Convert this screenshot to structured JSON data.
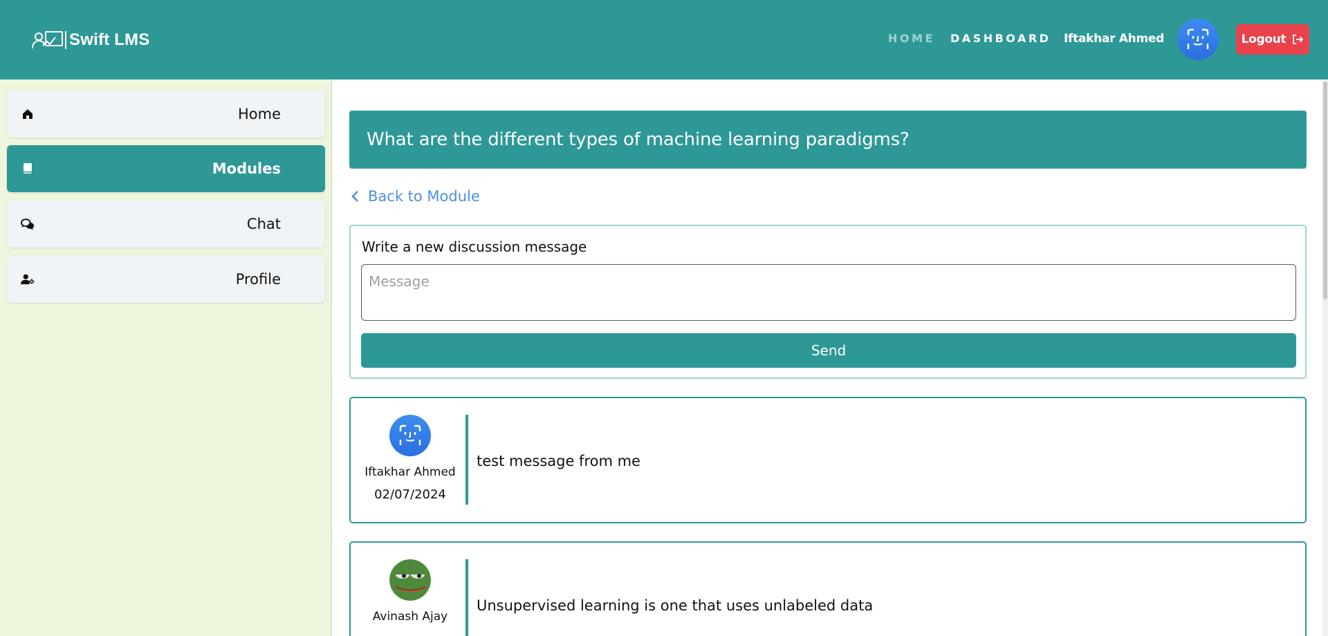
{
  "header": {
    "brand": "Swift LMS",
    "nav_home": "HOME",
    "nav_dashboard": "DASHBOARD",
    "user_name": "Iftakhar Ahmed",
    "logout_label": "Logout"
  },
  "sidebar": {
    "items": [
      {
        "label": "Home",
        "icon": "home-icon",
        "active": false
      },
      {
        "label": "Modules",
        "icon": "book-icon",
        "active": true
      },
      {
        "label": "Chat",
        "icon": "chat-icon",
        "active": false
      },
      {
        "label": "Profile",
        "icon": "user-settings-icon",
        "active": false
      }
    ]
  },
  "main": {
    "question_title": "What are the different types of machine learning paradigms?",
    "back_label": "Back to Module",
    "compose": {
      "label": "Write a new discussion message",
      "placeholder": "Message",
      "value": "",
      "send_label": "Send"
    },
    "posts": [
      {
        "author": "Iftakhar Ahmed",
        "date": "02/07/2024",
        "text": "test message from me",
        "avatar": "face-scan-avatar"
      },
      {
        "author": "Avinash Ajay",
        "date": "",
        "text": "Unsupervised learning is one that uses unlabeled data",
        "avatar": "frog-avatar"
      }
    ]
  },
  "colors": {
    "primary": "#2e9896",
    "sidebar_bg": "#eef7dd",
    "logout": "#e9424a",
    "link": "#4a90e2"
  }
}
